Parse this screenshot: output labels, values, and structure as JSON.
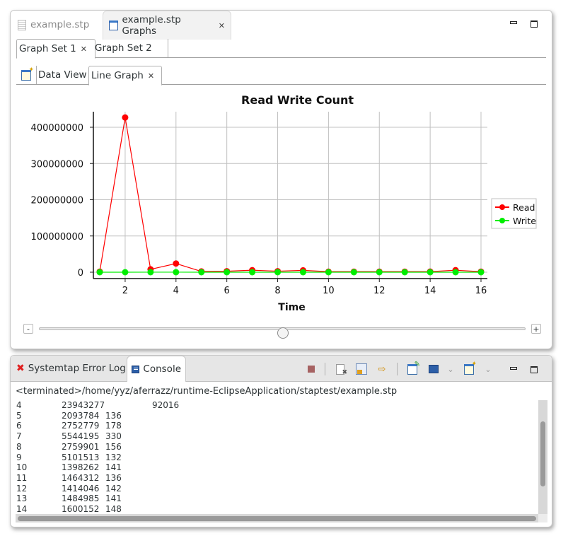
{
  "editor": {
    "tabs": [
      {
        "label": "example.stp",
        "icon": "text-file-icon",
        "active": false
      },
      {
        "label": "example.stp Graphs",
        "icon": "window-icon",
        "active": true,
        "closable": true
      }
    ],
    "window_controls": {
      "minimize": "minimize-icon",
      "maximize": "maximize-icon"
    }
  },
  "graph_sets": {
    "tabs": [
      {
        "label": "Graph Set 1",
        "active": true,
        "closable": true
      },
      {
        "label": "Graph Set 2",
        "active": false
      }
    ]
  },
  "view_tabs": {
    "new_graph_icon": "new-graph-icon",
    "tabs": [
      {
        "label": "Data View",
        "active": false
      },
      {
        "label": "Line Graph",
        "active": true,
        "closable": true
      }
    ]
  },
  "chart_data": {
    "type": "line",
    "title": "Read Write Count",
    "xlabel": "Time",
    "ylabel": "",
    "x": [
      1,
      2,
      3,
      4,
      5,
      6,
      7,
      8,
      9,
      10,
      11,
      12,
      13,
      14,
      15,
      16
    ],
    "series": [
      {
        "name": "Read",
        "color": "#ff0000",
        "values": [
          1500000,
          427000000,
          8000000,
          23943277,
          2093784,
          2752779,
          5544195,
          2759901,
          5101513,
          1398262,
          1464312,
          1414046,
          1484985,
          1600152,
          5500000,
          1500000
        ]
      },
      {
        "name": "Write",
        "color": "#00ee00",
        "values": [
          0,
          0,
          92016,
          92016,
          136,
          178,
          330,
          156,
          132,
          141,
          136,
          142,
          141,
          148,
          150,
          140
        ]
      }
    ],
    "xlim": [
      1,
      16
    ],
    "ylim": [
      0,
      440000000
    ],
    "xticks": [
      2,
      4,
      6,
      8,
      10,
      12,
      14,
      16
    ],
    "yticks": [
      0,
      100000000,
      200000000,
      300000000,
      400000000
    ],
    "ytick_labels": [
      "0",
      "100000000",
      "200000000",
      "300000000",
      "400000000"
    ],
    "grid": true,
    "legend_position": "right"
  },
  "zoom_slider": {
    "minus_label": "-",
    "plus_label": "+",
    "value": 0.5
  },
  "bottom": {
    "tabs": [
      {
        "label": "Systemtap Error Log",
        "icon": "error-x-icon",
        "active": false
      },
      {
        "label": "Console",
        "icon": "console-monitor-icon",
        "active": true
      }
    ],
    "toolbar": [
      "terminate-icon",
      "remove-launch-icon",
      "scroll-lock-icon",
      "word-wrap-icon",
      "pin-console-icon",
      "display-console-icon",
      "display-dropdown-icon",
      "open-console-icon",
      "open-dropdown-icon",
      "minimize-icon",
      "maximize-icon"
    ],
    "console": {
      "status": "<terminated>/home/yyz/aferrazz/runtime-EclipseApplication/staptest/example.stp",
      "lines": [
        [
          "4",
          "23943277",
          "",
          "92016"
        ],
        [
          "5",
          "2093784",
          "136",
          ""
        ],
        [
          "6",
          "2752779",
          "178",
          ""
        ],
        [
          "7",
          "5544195",
          "330",
          ""
        ],
        [
          "8",
          "2759901",
          "156",
          ""
        ],
        [
          "9",
          "5101513",
          "132",
          ""
        ],
        [
          "10",
          "1398262",
          "141",
          ""
        ],
        [
          "11",
          "1464312",
          "136",
          ""
        ],
        [
          "12",
          "1414046",
          "142",
          ""
        ],
        [
          "13",
          "1484985",
          "141",
          ""
        ],
        [
          "14",
          "1600152",
          "148",
          ""
        ]
      ]
    }
  }
}
